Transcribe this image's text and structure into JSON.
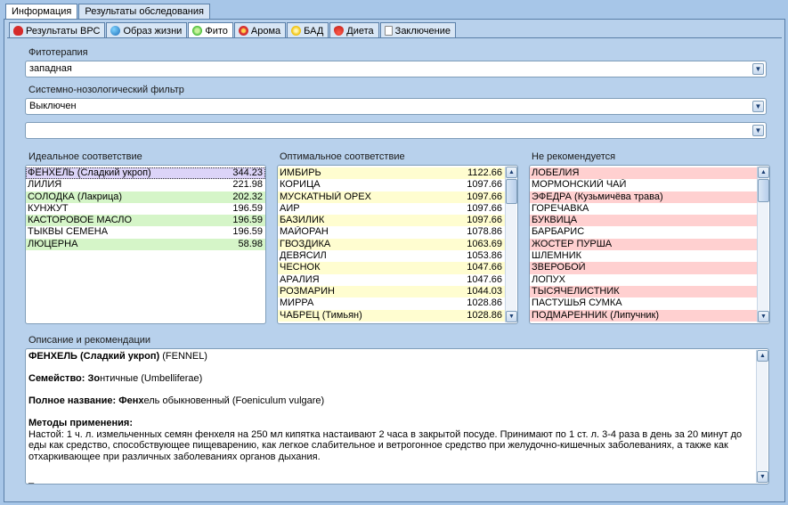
{
  "top_tabs": [
    "Информация",
    "Результаты обследования"
  ],
  "sub_tabs": [
    {
      "label": "Результаты ВРС",
      "icon": "heart-icon",
      "color": "#d62b2b"
    },
    {
      "label": "Образ жизни",
      "icon": "globe-icon",
      "color": "#2b8fd6"
    },
    {
      "label": "Фито",
      "icon": "leaf-icon",
      "color": "#3cb82e"
    },
    {
      "label": "Арома",
      "icon": "flower-icon",
      "color": "#d63030"
    },
    {
      "label": "БАД",
      "icon": "pill-icon",
      "color": "#f2c414"
    },
    {
      "label": "Диета",
      "icon": "strawberry-icon",
      "color": "#e2342c"
    },
    {
      "label": "Заключение",
      "icon": "document-icon",
      "color": "#ffffff"
    }
  ],
  "phytotherapy": {
    "label": "Фитотерапия",
    "value": "западная"
  },
  "filter": {
    "label": "Системно-нозологический фильтр",
    "value": "Выключен"
  },
  "extra_combo": {
    "value": ""
  },
  "ideal": {
    "label": "Идеальное соответствие",
    "items": [
      {
        "name": "ФЕНХЕЛЬ (Сладкий укроп)",
        "value": "344.23",
        "hl": "sel"
      },
      {
        "name": "ЛИЛИЯ",
        "value": "221.98",
        "hl": ""
      },
      {
        "name": "СОЛОДКА (Лакрица)",
        "value": "202.32",
        "hl": "g"
      },
      {
        "name": "КУНЖУТ",
        "value": "196.59",
        "hl": ""
      },
      {
        "name": "КАСТОРОВОЕ МАСЛО",
        "value": "196.59",
        "hl": "g"
      },
      {
        "name": "ТЫКВЫ СЕМЕНА",
        "value": "196.59",
        "hl": ""
      },
      {
        "name": "ЛЮЦЕРНА",
        "value": "58.98",
        "hl": "g"
      }
    ]
  },
  "optimal": {
    "label": "Оптимальное соответствие",
    "items": [
      {
        "name": "ИМБИРЬ",
        "value": "1122.66",
        "hl": "y"
      },
      {
        "name": "КОРИЦА",
        "value": "1097.66",
        "hl": ""
      },
      {
        "name": "МУСКАТНЫЙ ОРЕХ",
        "value": "1097.66",
        "hl": "y"
      },
      {
        "name": "АИР",
        "value": "1097.66",
        "hl": ""
      },
      {
        "name": "БАЗИЛИК",
        "value": "1097.66",
        "hl": "y"
      },
      {
        "name": "МАЙОРАН",
        "value": "1078.86",
        "hl": ""
      },
      {
        "name": "ГВОЗДИКА",
        "value": "1063.69",
        "hl": "y"
      },
      {
        "name": "ДЕВЯСИЛ",
        "value": "1053.86",
        "hl": ""
      },
      {
        "name": "ЧЕСНОК",
        "value": "1047.66",
        "hl": "y"
      },
      {
        "name": "АРАЛИЯ",
        "value": "1047.66",
        "hl": ""
      },
      {
        "name": "РОЗМАРИН",
        "value": "1044.03",
        "hl": "y"
      },
      {
        "name": "МИРРА",
        "value": "1028.86",
        "hl": ""
      },
      {
        "name": "ЧАБРЕЦ (Тимьян)",
        "value": "1028.86",
        "hl": "y"
      }
    ]
  },
  "not_recommended": {
    "label": "Не рекомендуется",
    "items": [
      {
        "name": "ЛОБЕЛИЯ",
        "hl": "r"
      },
      {
        "name": "МОРМОНСКИЙ ЧАЙ",
        "hl": ""
      },
      {
        "name": "ЭФЕДРА (Кузьмичёва трава)",
        "hl": "r"
      },
      {
        "name": "ГОРЕЧАВКА",
        "hl": ""
      },
      {
        "name": "БУКВИЦА",
        "hl": "r"
      },
      {
        "name": "БАРБАРИС",
        "hl": ""
      },
      {
        "name": "ЖОСТЕР ПУРША",
        "hl": "r"
      },
      {
        "name": "ШЛЕМНИК",
        "hl": ""
      },
      {
        "name": "ЗВЕРОБОЙ",
        "hl": "r"
      },
      {
        "name": "ЛОПУХ",
        "hl": ""
      },
      {
        "name": "ТЫСЯЧЕЛИСТНИК",
        "hl": "r"
      },
      {
        "name": "ПАСТУШЬЯ СУМКА",
        "hl": ""
      },
      {
        "name": "ПОДМАРЕННИК (Липучник)",
        "hl": "r"
      }
    ]
  },
  "description": {
    "label": "Описание и рекомендации",
    "title_bold": "ФЕНХЕЛЬ (Сладкий укроп)",
    "title_rest": " (FENNEL)",
    "family_bold": "Семейство: Зо",
    "family_rest": "нтичные (Umbelliferae)",
    "fullname_bold": "Полное название: Фенх",
    "fullname_rest": "ель обыкновенный (Foeniculum vulgare)",
    "methods_label": "Методы применения:",
    "methods_text": "Настой: 1 ч. л. измельченных семян фенхеля на 250 мл кипятка настаивают 2 часа в закрытой посуде. Принимают по 1 ст. л. 3-4 раза в день за 20 минут до еды как средство, способствующее пищеварению, как легкое слабительное и ветрогонное средство при желудочно-кишечных заболеваниях, а также как отхаркивающее при различных заболеваниях органов дыхания.",
    "cursor": "_"
  }
}
